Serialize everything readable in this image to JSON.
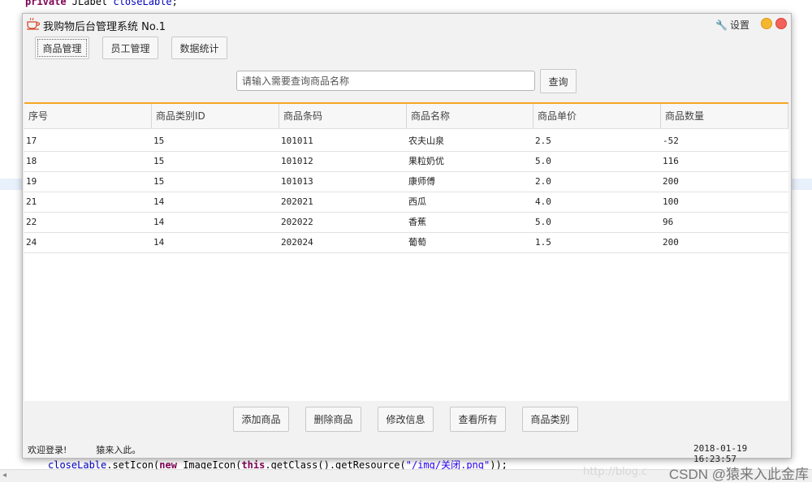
{
  "ide": {
    "code_top": {
      "kw": "private",
      "type": " JLabel ",
      "field": "closeLable",
      "tail": ";"
    },
    "code_bottom": {
      "obj": "closeLable",
      "m1": ".setIcon(",
      "kw_new": "new",
      "m2": " ImageIcon(",
      "kw_this": "this",
      "m3": ".getClass().getResource(",
      "str": "\"/img/关闭.png\"",
      "tail": "));"
    },
    "watermark": "CSDN @猿来入此金库",
    "watermark_faint": "http://blog.c"
  },
  "window": {
    "title": "我购物后台管理系统 No.1",
    "settings_label": "设置",
    "icons": {
      "app": "coffee-cup-icon",
      "settings": "wrench-icon",
      "minimize": "minimize-dot-icon",
      "close": "close-dot-icon"
    }
  },
  "toolbar": {
    "tabs": [
      "商品管理",
      "员工管理",
      "数据统计"
    ],
    "active_tab": "商品管理"
  },
  "search": {
    "placeholder": "请输入需要查询商品名称",
    "value": "",
    "button_label": "查询"
  },
  "table": {
    "accent_color": "#f5a623",
    "columns": [
      "序号",
      "商品类别ID",
      "商品条码",
      "商品名称",
      "商品单价",
      "商品数量"
    ],
    "rows": [
      [
        "17",
        "15",
        "101011",
        "农夫山泉",
        "2.5",
        "-52"
      ],
      [
        "18",
        "15",
        "101012",
        "果粒奶优",
        "5.0",
        "116"
      ],
      [
        "19",
        "15",
        "101013",
        "康师傅",
        "2.0",
        "200"
      ],
      [
        "21",
        "14",
        "202021",
        "西瓜",
        "4.0",
        "100"
      ],
      [
        "22",
        "14",
        "202022",
        "香蕉",
        "5.0",
        "96"
      ],
      [
        "24",
        "14",
        "202024",
        "葡萄",
        "1.5",
        "200"
      ]
    ]
  },
  "actions": [
    "添加商品",
    "删除商品",
    "修改信息",
    "查看所有",
    "商品类别"
  ],
  "status": {
    "welcome": "欢迎登录!",
    "user": "猿来入此。",
    "datetime": "2018-01-19 16:23:57"
  }
}
